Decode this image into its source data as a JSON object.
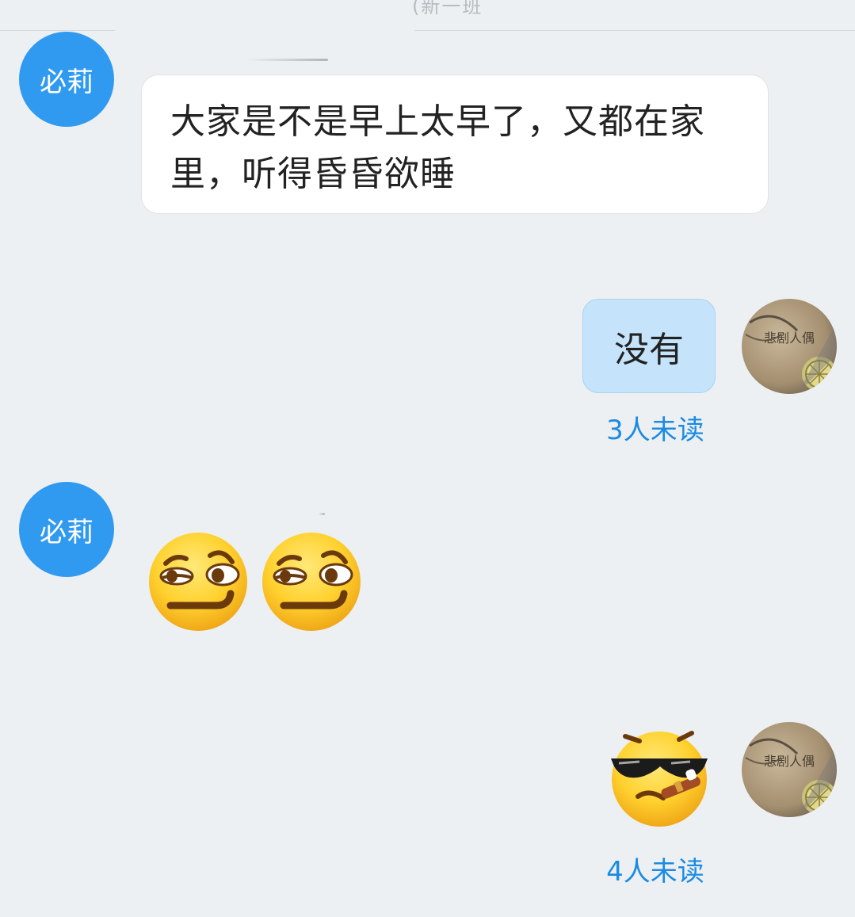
{
  "header": {
    "title": "(新一班"
  },
  "messages": [
    {
      "direction": "incoming",
      "avatar_text": "必莉",
      "text": "大家是不是早上太早了，又都在家里，听得昏昏欲睡"
    },
    {
      "direction": "outgoing",
      "text": "没有",
      "read_status": "3人未读",
      "avatar_caption": "悲剧人偶"
    },
    {
      "direction": "incoming",
      "avatar_text": "必莉",
      "emoji": [
        "smirk-face-icon",
        "smirk-face-icon"
      ]
    },
    {
      "direction": "outgoing",
      "emoji": [
        "cool-cigar-face-icon"
      ],
      "read_status": "4人未读",
      "avatar_caption": "悲剧人偶"
    }
  ],
  "colors": {
    "background": "#edf0f2",
    "avatar_blue": "#2f9af0",
    "outgoing_bubble": "#c5e4fb",
    "read_status": "#1b8be3"
  }
}
